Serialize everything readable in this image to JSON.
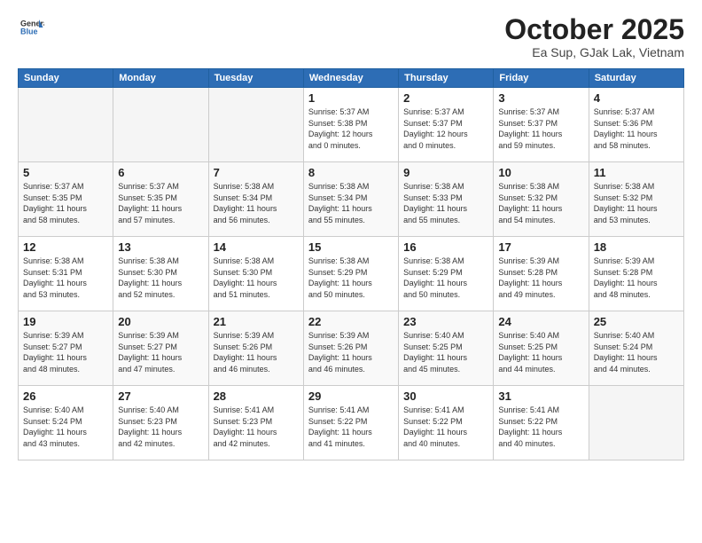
{
  "header": {
    "logo_line1": "General",
    "logo_line2": "Blue",
    "month": "October 2025",
    "location": "Ea Sup, GJak Lak, Vietnam"
  },
  "weekdays": [
    "Sunday",
    "Monday",
    "Tuesday",
    "Wednesday",
    "Thursday",
    "Friday",
    "Saturday"
  ],
  "weeks": [
    [
      {
        "day": "",
        "info": ""
      },
      {
        "day": "",
        "info": ""
      },
      {
        "day": "",
        "info": ""
      },
      {
        "day": "1",
        "info": "Sunrise: 5:37 AM\nSunset: 5:38 PM\nDaylight: 12 hours\nand 0 minutes."
      },
      {
        "day": "2",
        "info": "Sunrise: 5:37 AM\nSunset: 5:37 PM\nDaylight: 12 hours\nand 0 minutes."
      },
      {
        "day": "3",
        "info": "Sunrise: 5:37 AM\nSunset: 5:37 PM\nDaylight: 11 hours\nand 59 minutes."
      },
      {
        "day": "4",
        "info": "Sunrise: 5:37 AM\nSunset: 5:36 PM\nDaylight: 11 hours\nand 58 minutes."
      }
    ],
    [
      {
        "day": "5",
        "info": "Sunrise: 5:37 AM\nSunset: 5:35 PM\nDaylight: 11 hours\nand 58 minutes."
      },
      {
        "day": "6",
        "info": "Sunrise: 5:37 AM\nSunset: 5:35 PM\nDaylight: 11 hours\nand 57 minutes."
      },
      {
        "day": "7",
        "info": "Sunrise: 5:38 AM\nSunset: 5:34 PM\nDaylight: 11 hours\nand 56 minutes."
      },
      {
        "day": "8",
        "info": "Sunrise: 5:38 AM\nSunset: 5:34 PM\nDaylight: 11 hours\nand 55 minutes."
      },
      {
        "day": "9",
        "info": "Sunrise: 5:38 AM\nSunset: 5:33 PM\nDaylight: 11 hours\nand 55 minutes."
      },
      {
        "day": "10",
        "info": "Sunrise: 5:38 AM\nSunset: 5:32 PM\nDaylight: 11 hours\nand 54 minutes."
      },
      {
        "day": "11",
        "info": "Sunrise: 5:38 AM\nSunset: 5:32 PM\nDaylight: 11 hours\nand 53 minutes."
      }
    ],
    [
      {
        "day": "12",
        "info": "Sunrise: 5:38 AM\nSunset: 5:31 PM\nDaylight: 11 hours\nand 53 minutes."
      },
      {
        "day": "13",
        "info": "Sunrise: 5:38 AM\nSunset: 5:30 PM\nDaylight: 11 hours\nand 52 minutes."
      },
      {
        "day": "14",
        "info": "Sunrise: 5:38 AM\nSunset: 5:30 PM\nDaylight: 11 hours\nand 51 minutes."
      },
      {
        "day": "15",
        "info": "Sunrise: 5:38 AM\nSunset: 5:29 PM\nDaylight: 11 hours\nand 50 minutes."
      },
      {
        "day": "16",
        "info": "Sunrise: 5:38 AM\nSunset: 5:29 PM\nDaylight: 11 hours\nand 50 minutes."
      },
      {
        "day": "17",
        "info": "Sunrise: 5:39 AM\nSunset: 5:28 PM\nDaylight: 11 hours\nand 49 minutes."
      },
      {
        "day": "18",
        "info": "Sunrise: 5:39 AM\nSunset: 5:28 PM\nDaylight: 11 hours\nand 48 minutes."
      }
    ],
    [
      {
        "day": "19",
        "info": "Sunrise: 5:39 AM\nSunset: 5:27 PM\nDaylight: 11 hours\nand 48 minutes."
      },
      {
        "day": "20",
        "info": "Sunrise: 5:39 AM\nSunset: 5:27 PM\nDaylight: 11 hours\nand 47 minutes."
      },
      {
        "day": "21",
        "info": "Sunrise: 5:39 AM\nSunset: 5:26 PM\nDaylight: 11 hours\nand 46 minutes."
      },
      {
        "day": "22",
        "info": "Sunrise: 5:39 AM\nSunset: 5:26 PM\nDaylight: 11 hours\nand 46 minutes."
      },
      {
        "day": "23",
        "info": "Sunrise: 5:40 AM\nSunset: 5:25 PM\nDaylight: 11 hours\nand 45 minutes."
      },
      {
        "day": "24",
        "info": "Sunrise: 5:40 AM\nSunset: 5:25 PM\nDaylight: 11 hours\nand 44 minutes."
      },
      {
        "day": "25",
        "info": "Sunrise: 5:40 AM\nSunset: 5:24 PM\nDaylight: 11 hours\nand 44 minutes."
      }
    ],
    [
      {
        "day": "26",
        "info": "Sunrise: 5:40 AM\nSunset: 5:24 PM\nDaylight: 11 hours\nand 43 minutes."
      },
      {
        "day": "27",
        "info": "Sunrise: 5:40 AM\nSunset: 5:23 PM\nDaylight: 11 hours\nand 42 minutes."
      },
      {
        "day": "28",
        "info": "Sunrise: 5:41 AM\nSunset: 5:23 PM\nDaylight: 11 hours\nand 42 minutes."
      },
      {
        "day": "29",
        "info": "Sunrise: 5:41 AM\nSunset: 5:22 PM\nDaylight: 11 hours\nand 41 minutes."
      },
      {
        "day": "30",
        "info": "Sunrise: 5:41 AM\nSunset: 5:22 PM\nDaylight: 11 hours\nand 40 minutes."
      },
      {
        "day": "31",
        "info": "Sunrise: 5:41 AM\nSunset: 5:22 PM\nDaylight: 11 hours\nand 40 minutes."
      },
      {
        "day": "",
        "info": ""
      }
    ]
  ]
}
